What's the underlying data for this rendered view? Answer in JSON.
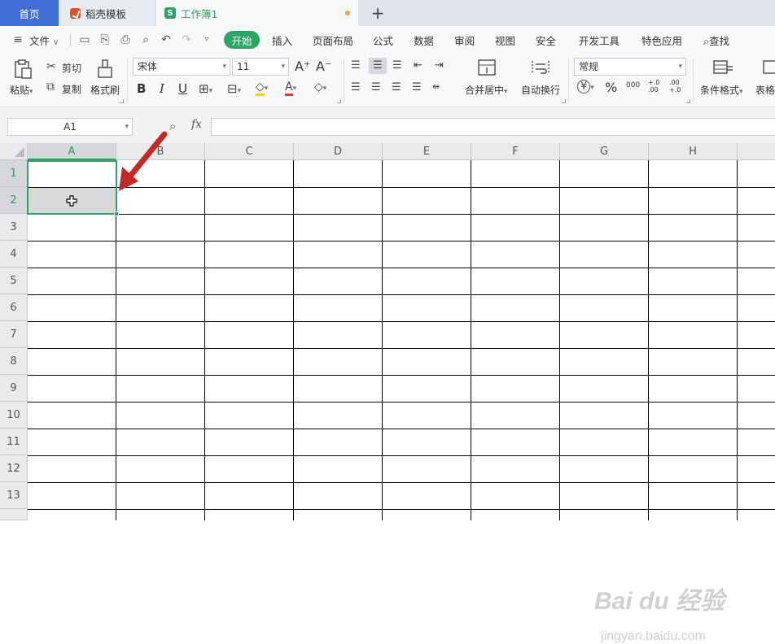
{
  "tabs": {
    "home": "首页",
    "templates": "稻壳模板",
    "workbook": "工作簿1",
    "workbook_icon": "S",
    "new_tab": "+"
  },
  "menu": {
    "file": "文件",
    "items": [
      "开始",
      "插入",
      "页面布局",
      "公式",
      "数据",
      "审阅",
      "视图",
      "安全",
      "开发工具",
      "特色应用"
    ],
    "search": "查找"
  },
  "ribbon": {
    "paste": "粘贴",
    "cut": "剪切",
    "copy": "复制",
    "format_painter": "格式刷",
    "font_name": "宋体",
    "font_size": "11",
    "grow_font": "A⁺",
    "shrink_font": "A⁻",
    "bold": "B",
    "italic": "I",
    "underline": "U",
    "font_color_glyph": "A",
    "merge_center": "合并居中",
    "wrap_text": "自动换行",
    "number_format": "常规",
    "currency": "¥",
    "percent": "%",
    "thousands": "000",
    "inc_decimal": "+.0 .00",
    "dec_decimal": ".00 +.0",
    "conditional_format": "条件格式",
    "table_style": "表格"
  },
  "formula_bar": {
    "name_box": "A1",
    "fx": "fx",
    "formula": ""
  },
  "grid": {
    "columns": [
      "A",
      "B",
      "C",
      "D",
      "E",
      "F",
      "G",
      "H"
    ],
    "rows": [
      "1",
      "2",
      "3",
      "4",
      "5",
      "6",
      "7",
      "8",
      "9",
      "10",
      "11",
      "12",
      "13"
    ],
    "active_column": "A",
    "active_rows": [
      "1",
      "2"
    ]
  },
  "watermark": {
    "brand": "Bai du 经验",
    "url": "jingyan.baidu.com"
  },
  "colors": {
    "accent": "#2aa564",
    "home_tab": "#3f6fd6",
    "annotation_arrow": "#c62828"
  },
  "icons": [
    "templates-icon",
    "sheet-icon",
    "menu-icon",
    "save-icon",
    "print-icon",
    "undo-icon",
    "redo-icon",
    "search-icon",
    "paste-icon",
    "scissors-icon",
    "copy-icon",
    "format-brush-icon",
    "border-icon",
    "fill-color-icon",
    "eraser-icon",
    "align-icons",
    "merge-icon",
    "wrap-icon",
    "conditional-format-icon",
    "zoom-formula-icon",
    "crosshair-cursor-icon",
    "red-arrow-annotation"
  ]
}
